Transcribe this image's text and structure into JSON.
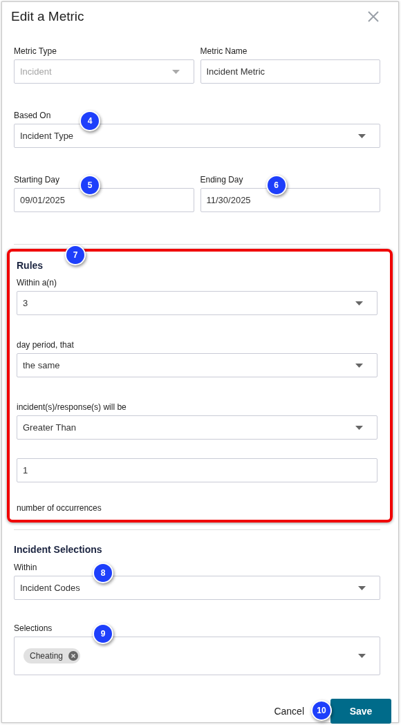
{
  "dialog": {
    "title": "Edit a Metric"
  },
  "general": {
    "rows": [
      [
        {
          "kind": "select",
          "label": "Metric Type",
          "value": "Incident",
          "disabled": true
        },
        {
          "kind": "input",
          "label": "Metric Name",
          "value": "Incident Metric",
          "disabled": false
        }
      ],
      [
        {
          "kind": "select",
          "label": "Based On",
          "value": "Incident Type",
          "disabled": false,
          "callout": "4"
        }
      ],
      [
        {
          "kind": "input",
          "label": "Starting Day",
          "value": "09/01/2025",
          "disabled": false,
          "callout": "5"
        },
        {
          "kind": "input",
          "label": "Ending Day",
          "value": "11/30/2025",
          "disabled": false,
          "callout": "6"
        }
      ]
    ]
  },
  "rules": {
    "title": "Rules",
    "highlighted": true,
    "callout": "7",
    "fields": [
      {
        "kind": "select",
        "label": "Within a(n)",
        "value": "3",
        "disabled": false
      },
      {
        "kind": "select",
        "label": "day period, that",
        "value": "the same",
        "disabled": false
      },
      {
        "kind": "select",
        "label": "incident(s)/response(s) will be",
        "value": "Greater Than",
        "disabled": false
      },
      {
        "kind": "input",
        "value": "1",
        "disabled": false
      }
    ],
    "note": "number of occurrences"
  },
  "selections": {
    "title": "Incident Selections",
    "fields": [
      {
        "kind": "select",
        "label": "Within",
        "value": "Incident Codes",
        "disabled": false,
        "callout": "8"
      },
      {
        "kind": "multiselect",
        "label": "Selections",
        "chips": [
          "Cheating"
        ],
        "disabled": false,
        "callout": "9"
      }
    ]
  },
  "footer": {
    "buttons": [
      {
        "kind": "link",
        "label": "Cancel"
      },
      {
        "kind": "primary",
        "label": "Save",
        "callout": "10"
      }
    ]
  }
}
